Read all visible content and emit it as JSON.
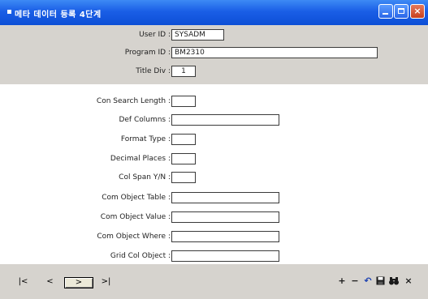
{
  "window": {
    "title": "메타 데이터 등록 4단계",
    "controls": {
      "minimize_icon": "minimize-icon",
      "maximize_icon": "maximize-icon",
      "close_icon": "close-icon",
      "close_glyph": "×"
    }
  },
  "header": {
    "user_id_label": "User ID :",
    "user_id_value": "SYSADM",
    "program_id_label": "Program ID :",
    "program_id_value": "BM2310",
    "title_div_label": "Title Div :",
    "title_div_value": "1"
  },
  "form": {
    "fields": [
      {
        "label": "Con Search Length :",
        "value": ""
      },
      {
        "label": "Def Columns :",
        "value": ""
      },
      {
        "label": "Format Type :",
        "value": ""
      },
      {
        "label": "Decimal Places :",
        "value": ""
      },
      {
        "label": "Col Span Y/N :",
        "value": ""
      },
      {
        "label": "Com Object Table :",
        "value": ""
      },
      {
        "label": "Com Object Value :",
        "value": ""
      },
      {
        "label": "Com Object Where :",
        "value": ""
      },
      {
        "label": "Grid Col Object :",
        "value": ""
      }
    ]
  },
  "navigation": {
    "first": "|<",
    "prev": "<",
    "next": ">",
    "last": ">|"
  },
  "actions": {
    "add": "+",
    "remove": "−",
    "undo": "↶",
    "save": "💾",
    "find": "👓",
    "close": "×"
  },
  "colors": {
    "titlebar": "#1a5ee6",
    "panel": "#d6d3ce",
    "content": "#ffffff"
  }
}
